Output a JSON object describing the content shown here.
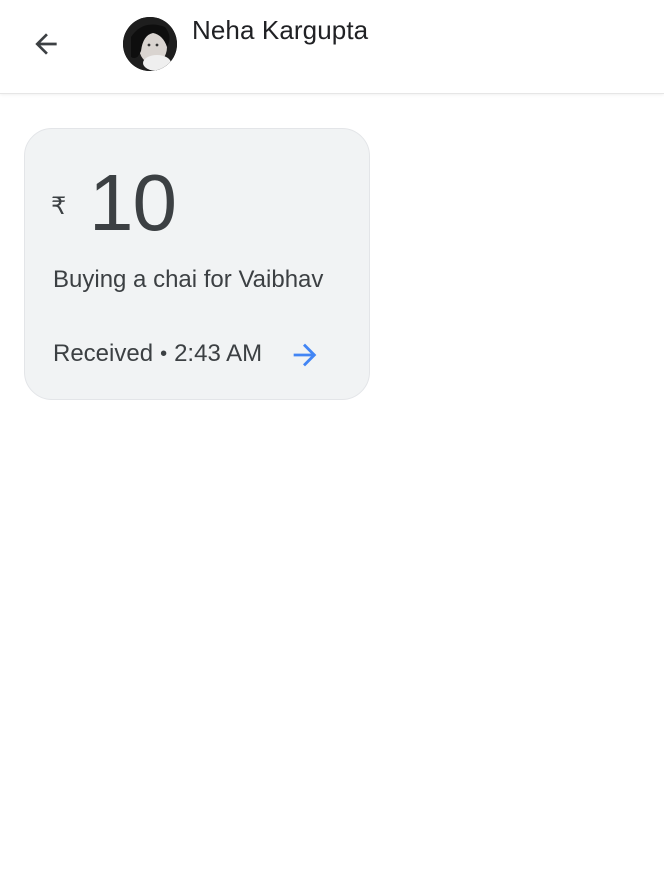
{
  "header": {
    "back_icon": "arrow-back-icon",
    "contact_name": "Neha Kargupta",
    "avatar": "contact-avatar-photo"
  },
  "payment": {
    "currency_symbol": "₹",
    "amount": "10",
    "note": "Buying a chai for Vaibhav",
    "status": "Received",
    "separator": "•",
    "time": "2:43 AM",
    "details_icon": "arrow-forward-icon"
  },
  "colors": {
    "accent": "#4285f4",
    "card_background": "#f1f3f4",
    "text": "#3c4043"
  }
}
